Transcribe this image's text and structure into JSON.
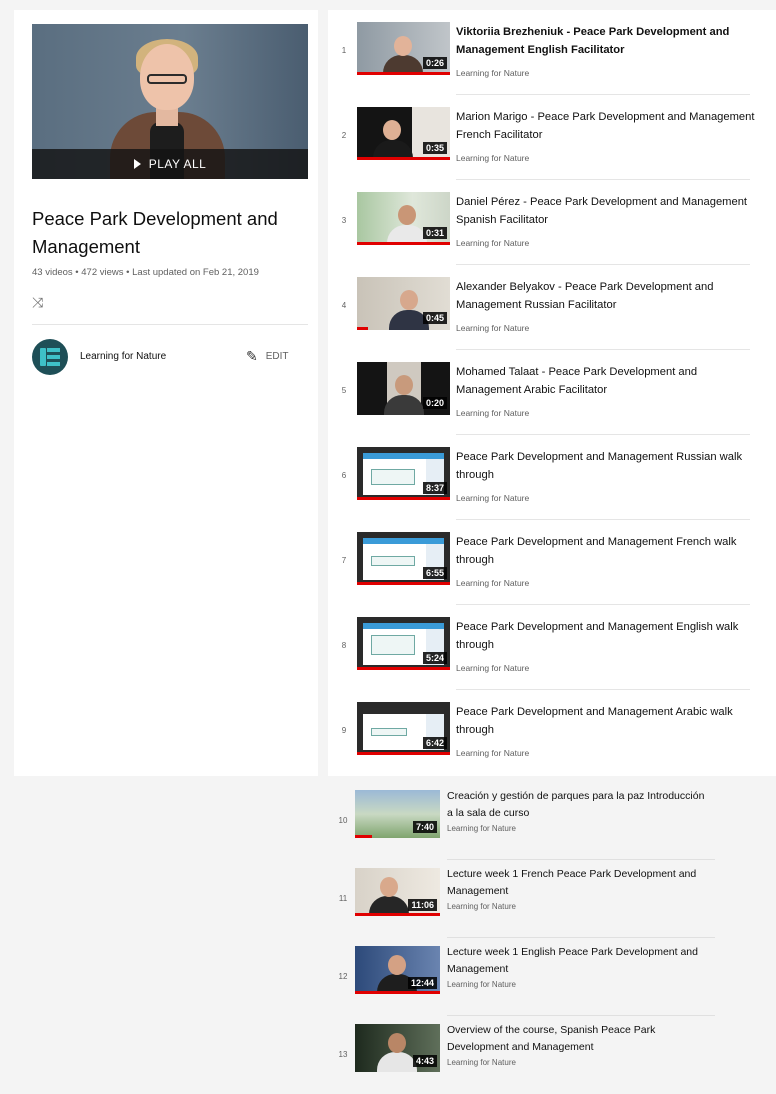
{
  "playlist": {
    "title": "Peace Park Development and Management",
    "stats": "43 videos • 472 views • Last updated on Feb 21, 2019",
    "play_all": "PLAY ALL",
    "owner": "Learning for Nature",
    "edit": "EDIT"
  },
  "videos": [
    {
      "index": "1",
      "title": "Viktoriia Brezheniuk - Peace Park Development and Management English Facilitator",
      "duration": "0:26",
      "channel": "Learning for Nature"
    },
    {
      "index": "2",
      "title": "Marion Marigo - Peace Park Development and Management French Facilitator",
      "duration": "0:35",
      "channel": "Learning for Nature"
    },
    {
      "index": "3",
      "title": "Daniel Pérez - Peace Park Development and Management Spanish Facilitator",
      "duration": "0:31",
      "channel": "Learning for Nature"
    },
    {
      "index": "4",
      "title": "Alexander Belyakov - Peace Park Development and Management Russian Facilitator",
      "duration": "0:45",
      "channel": "Learning for Nature"
    },
    {
      "index": "5",
      "title": "Mohamed Talaat - Peace Park Development and Management Arabic Facilitator",
      "duration": "0:20",
      "channel": "Learning for Nature"
    },
    {
      "index": "6",
      "title": "Peace Park Development and Management Russian walk through",
      "duration": "8:37",
      "channel": "Learning for Nature"
    },
    {
      "index": "7",
      "title": "Peace Park Development and Management French walk through",
      "duration": "6:55",
      "channel": "Learning for Nature"
    },
    {
      "index": "8",
      "title": "Peace Park Development and Management English walk through",
      "duration": "5:24",
      "channel": "Learning for Nature"
    },
    {
      "index": "9",
      "title": "Peace Park Development and Management Arabic walk through",
      "duration": "6:42",
      "channel": "Learning for Nature"
    },
    {
      "index": "10",
      "title": "Creación y gestión de parques para la paz Introducción a la sala de curso",
      "duration": "7:40",
      "channel": "Learning for Nature"
    },
    {
      "index": "11",
      "title": "Lecture week 1 French Peace Park Development and Management",
      "duration": "11:06",
      "channel": "Learning for Nature"
    },
    {
      "index": "12",
      "title": "Lecture week 1 English Peace Park Development and Management",
      "duration": "12:44",
      "channel": "Learning for Nature"
    },
    {
      "index": "13",
      "title": "Overview of the course, Spanish Peace Park Development and Management",
      "duration": "4:43",
      "channel": "Learning for Nature"
    }
  ],
  "icons": {
    "play": "play-icon",
    "shuffle": "shuffle-icon",
    "edit": "pencil-icon",
    "avatar": "learning-for-nature-logo"
  },
  "colors": {
    "accent_red": "#e00000",
    "avatar_bg": "#1e4f57",
    "avatar_fg": "#3ec0c7"
  }
}
